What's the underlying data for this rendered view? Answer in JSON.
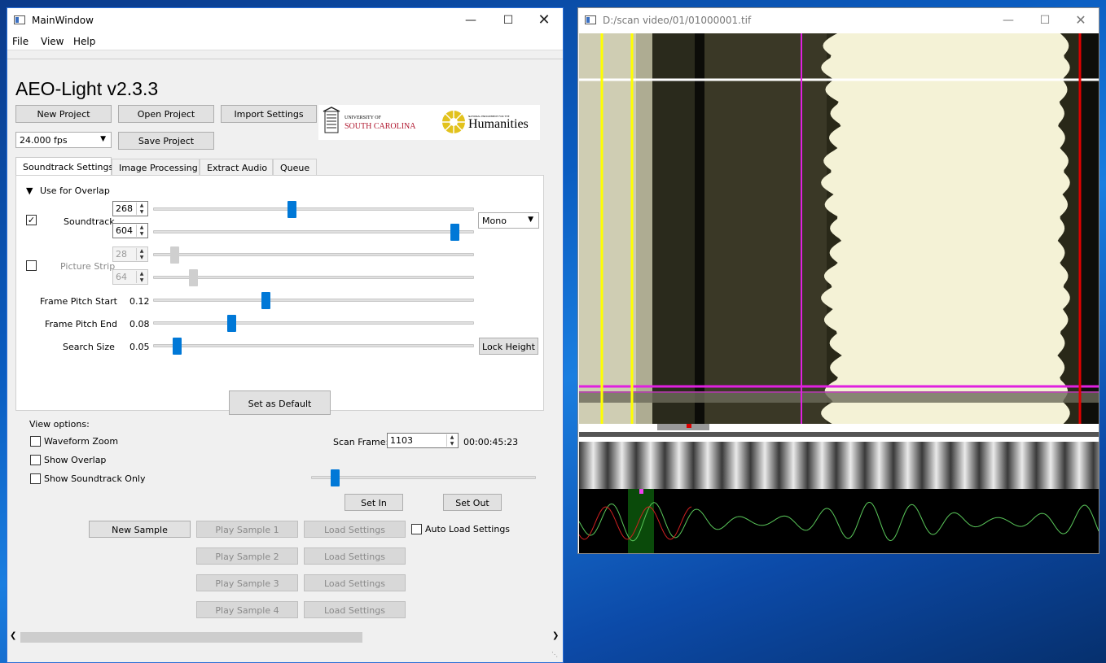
{
  "main_window": {
    "title": "MainWindow",
    "menu": [
      "File",
      "View",
      "Help"
    ],
    "app_title": "AEO-Light v2.3.3",
    "buttons": {
      "new_project": "New Project",
      "open_project": "Open Project",
      "import_settings": "Import Settings",
      "save_project": "Save Project"
    },
    "fps_select": "24.000 fps",
    "logos": {
      "usc_line1": "UNIVERSITY OF",
      "usc_line2": "SOUTH CAROLINA",
      "neh_small": "NATIONAL ENDOWMENT FOR THE",
      "neh_big": "Humanities"
    },
    "tabs": [
      "Soundtrack Settings",
      "Image Processing",
      "Extract Audio",
      "Queue"
    ],
    "panel": {
      "use_for_overlap": "Use for Overlap",
      "soundtrack_label": "Soundtrack",
      "soundtrack_checked": true,
      "soundtrack_start": "268",
      "soundtrack_end": "604",
      "soundtrack_start_level": 0.428,
      "soundtrack_end_level": 0.951,
      "channel_mode": "Mono",
      "picture_strip_label": "Picture Strip",
      "picture_strip_checked": false,
      "picture_start": "28",
      "picture_end": "64",
      "picture_start_level": 0.051,
      "picture_end_level": 0.112,
      "frame_pitch_start_label": "Frame Pitch Start",
      "frame_pitch_start": "0.12",
      "frame_pitch_start_level": 0.345,
      "frame_pitch_end_label": "Frame Pitch End",
      "frame_pitch_end": "0.08",
      "frame_pitch_end_level": 0.235,
      "search_size_label": "Search Size",
      "search_size": "0.05",
      "search_size_level": 0.061,
      "lock_height": "Lock Height",
      "set_default": "Set as Default"
    },
    "view_options": {
      "title": "View options:",
      "waveform_zoom": "Waveform Zoom",
      "show_overlap": "Show Overlap",
      "show_soundtrack_only": "Show Soundtrack Only"
    },
    "scan_frame_label": "Scan Frame:",
    "scan_frame_value": "1103",
    "timecode": "00:00:45:23",
    "scan_slider_level": 0.085,
    "set_in": "Set In",
    "set_out": "Set Out",
    "new_sample": "New Sample",
    "play_samples": [
      "Play Sample 1",
      "Play Sample 2",
      "Play Sample 3",
      "Play Sample 4"
    ],
    "load_settings": "Load Settings",
    "auto_load_settings": "Auto Load Settings"
  },
  "image_window": {
    "title": "D:/scan video/01/01000001.tif"
  },
  "colors": {
    "accent": "#0078d7",
    "guide_yellow": "#ffff00",
    "guide_magenta": "#e020e0",
    "guide_red": "#e00000",
    "wave_green": "#5ac85a",
    "wave_red": "#d02020"
  }
}
